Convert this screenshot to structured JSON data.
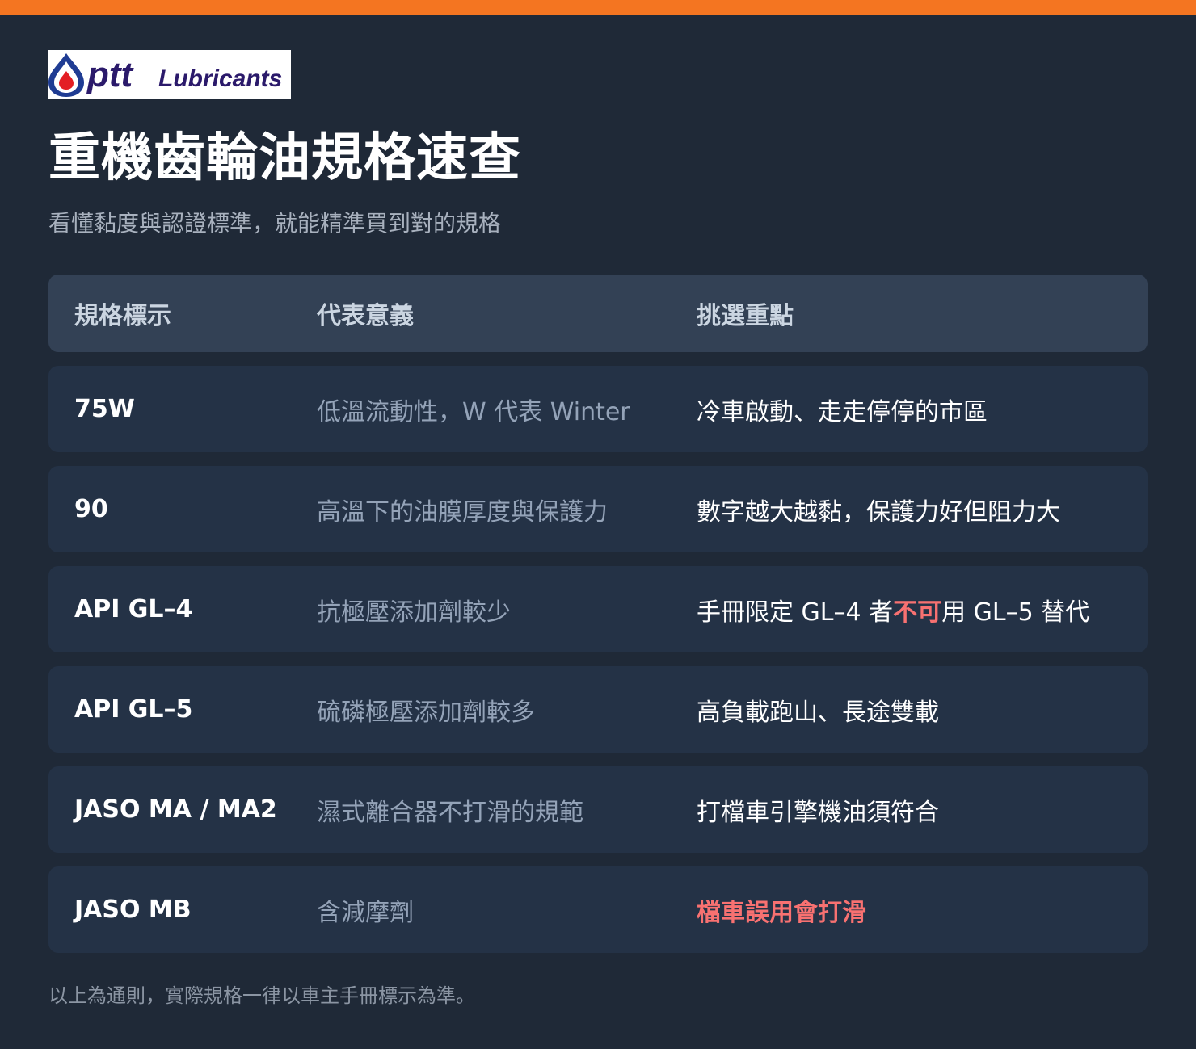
{
  "colors": {
    "accent": "#f47521",
    "background": "#1f2937",
    "warning": "#f87171",
    "logo_blue": "#1f3c93",
    "logo_red": "#e31e24",
    "logo_purple": "#2b1a6b"
  },
  "logo": {
    "icon": "oil-drop-icon",
    "text_main": "ptt",
    "text_sub": "Lubricants"
  },
  "title": "重機齒輪油規格速查",
  "subtitle": "看懂黏度與認證標準，就能精準買到對的規格",
  "table": {
    "headers": [
      "規格標示",
      "代表意義",
      "挑選重點"
    ],
    "rows": [
      {
        "spec": "75W",
        "meaning": "低溫流動性，W 代表 Winter",
        "tip": "冷車啟動、走走停停的市區"
      },
      {
        "spec": "90",
        "meaning": "高溫下的油膜厚度與保護力",
        "tip": "數字越大越黏，保護力好但阻力大"
      },
      {
        "spec": "API GL–4",
        "meaning": "抗極壓添加劑較少",
        "tip_before": "手冊限定 GL–4 者",
        "tip_highlight": "不可",
        "tip_after": "用 GL–5 替代"
      },
      {
        "spec": "API GL–5",
        "meaning": "硫磷極壓添加劑較多",
        "tip": "高負載跑山、長途雙載"
      },
      {
        "spec": "JASO MA / MA2",
        "meaning": "濕式離合器不打滑的規範",
        "tip": "打檔車引擎機油須符合"
      },
      {
        "spec": "JASO MB",
        "meaning": "含減摩劑",
        "tip": "檔車誤用會打滑"
      }
    ]
  },
  "footer": "以上為通則，實際規格一律以車主手冊標示為準。"
}
